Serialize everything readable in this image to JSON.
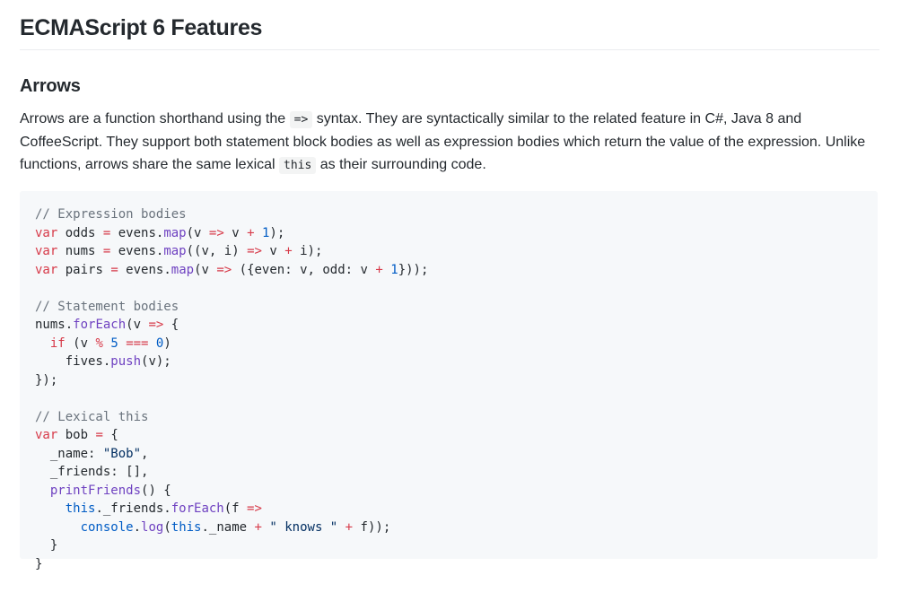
{
  "title": "ECMAScript 6 Features",
  "section": {
    "heading": "Arrows",
    "paragraph": {
      "part1": "Arrows are a function shorthand using the ",
      "code1": "=>",
      "part2": " syntax. They are syntactically similar to the related feature in C#, Java 8 and CoffeeScript. They support both statement block bodies as well as expression bodies which return the value of the expression. Unlike functions, arrows share the same lexical ",
      "code2": "this",
      "part3": " as their surrounding code."
    }
  },
  "code_lines": [
    [
      [
        "comment",
        "// Expression bodies"
      ]
    ],
    [
      [
        "kw",
        "var"
      ],
      [
        "plain",
        " odds "
      ],
      [
        "kw",
        "="
      ],
      [
        "plain",
        " evens."
      ],
      [
        "fn",
        "map"
      ],
      [
        "plain",
        "(v "
      ],
      [
        "kw",
        "=>"
      ],
      [
        "plain",
        " v "
      ],
      [
        "kw",
        "+"
      ],
      [
        "plain",
        " "
      ],
      [
        "num",
        "1"
      ],
      [
        "plain",
        ");"
      ]
    ],
    [
      [
        "kw",
        "var"
      ],
      [
        "plain",
        " nums "
      ],
      [
        "kw",
        "="
      ],
      [
        "plain",
        " evens."
      ],
      [
        "fn",
        "map"
      ],
      [
        "plain",
        "((v, i) "
      ],
      [
        "kw",
        "=>"
      ],
      [
        "plain",
        " v "
      ],
      [
        "kw",
        "+"
      ],
      [
        "plain",
        " i);"
      ]
    ],
    [
      [
        "kw",
        "var"
      ],
      [
        "plain",
        " pairs "
      ],
      [
        "kw",
        "="
      ],
      [
        "plain",
        " evens."
      ],
      [
        "fn",
        "map"
      ],
      [
        "plain",
        "(v "
      ],
      [
        "kw",
        "=>"
      ],
      [
        "plain",
        " ({even: v, odd: v "
      ],
      [
        "kw",
        "+"
      ],
      [
        "plain",
        " "
      ],
      [
        "num",
        "1"
      ],
      [
        "plain",
        "}));"
      ]
    ],
    [],
    [
      [
        "comment",
        "// Statement bodies"
      ]
    ],
    [
      [
        "plain",
        "nums."
      ],
      [
        "fn",
        "forEach"
      ],
      [
        "plain",
        "(v "
      ],
      [
        "kw",
        "=>"
      ],
      [
        "plain",
        " {"
      ]
    ],
    [
      [
        "plain",
        "  "
      ],
      [
        "kw",
        "if"
      ],
      [
        "plain",
        " (v "
      ],
      [
        "kw",
        "%"
      ],
      [
        "plain",
        " "
      ],
      [
        "num",
        "5"
      ],
      [
        "plain",
        " "
      ],
      [
        "kw",
        "==="
      ],
      [
        "plain",
        " "
      ],
      [
        "num",
        "0"
      ],
      [
        "plain",
        ")"
      ]
    ],
    [
      [
        "plain",
        "    fives."
      ],
      [
        "fn",
        "push"
      ],
      [
        "plain",
        "(v);"
      ]
    ],
    [
      [
        "plain",
        "});"
      ]
    ],
    [],
    [
      [
        "comment",
        "// Lexical this"
      ]
    ],
    [
      [
        "kw",
        "var"
      ],
      [
        "plain",
        " bob "
      ],
      [
        "kw",
        "="
      ],
      [
        "plain",
        " {"
      ]
    ],
    [
      [
        "plain",
        "  _name: "
      ],
      [
        "str",
        "\"Bob\""
      ],
      [
        "plain",
        ","
      ]
    ],
    [
      [
        "plain",
        "  _friends: [],"
      ]
    ],
    [
      [
        "plain",
        "  "
      ],
      [
        "fn",
        "printFriends"
      ],
      [
        "plain",
        "() {"
      ]
    ],
    [
      [
        "plain",
        "    "
      ],
      [
        "num",
        "this"
      ],
      [
        "plain",
        "._friends."
      ],
      [
        "fn",
        "forEach"
      ],
      [
        "plain",
        "(f "
      ],
      [
        "kw",
        "=>"
      ]
    ],
    [
      [
        "plain",
        "      "
      ],
      [
        "num",
        "console"
      ],
      [
        "plain",
        "."
      ],
      [
        "fn",
        "log"
      ],
      [
        "plain",
        "("
      ],
      [
        "num",
        "this"
      ],
      [
        "plain",
        "._name "
      ],
      [
        "kw",
        "+"
      ],
      [
        "plain",
        " "
      ],
      [
        "str",
        "\" knows \""
      ],
      [
        "plain",
        " "
      ],
      [
        "kw",
        "+"
      ],
      [
        "plain",
        " f));"
      ]
    ],
    [
      [
        "plain",
        "  }"
      ]
    ],
    [
      [
        "plain",
        "}"
      ]
    ]
  ]
}
